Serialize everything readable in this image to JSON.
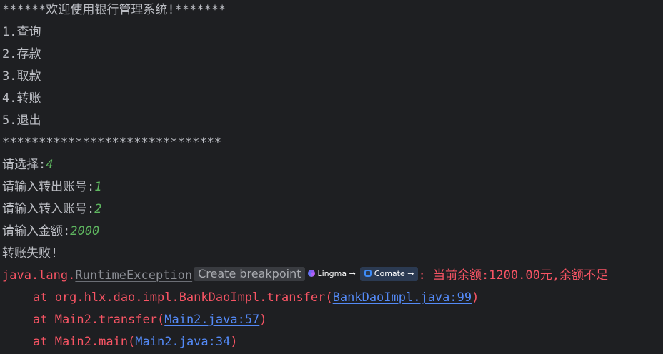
{
  "console": {
    "welcome": "******欢迎使用银行管理系统!*******",
    "menu": [
      "1.查询",
      "2.存款",
      "3.取款",
      "4.转账",
      "5.退出"
    ],
    "separator": "******************************",
    "prompt_choice": "请选择:",
    "input_choice": "4",
    "prompt_from": "请输入转出账号:",
    "input_from": "1",
    "prompt_to": "请输入转入账号:",
    "input_to": "2",
    "prompt_amount": "请输入金额:",
    "input_amount": "2000",
    "result": "转账失败!",
    "exception": {
      "package": "java.lang.",
      "class": "RuntimeException",
      "message": ": 当前余额:1200.00元,余额不足",
      "stack": [
        {
          "prefix": "at org.hlx.dao.impl.BankDaoImpl.transfer(",
          "link": "BankDaoImpl.java:99",
          "suffix": ")"
        },
        {
          "prefix": "at Main2.transfer(",
          "link": "Main2.java:57",
          "suffix": ")"
        },
        {
          "prefix": "at Main2.main(",
          "link": "Main2.java:34",
          "suffix": ")"
        }
      ]
    }
  },
  "widgets": {
    "create_breakpoint": "Create breakpoint",
    "lingma_label": "Lingma →",
    "comate_label": "Comate →",
    "lingma_icon": "lingma-logo-icon",
    "comate_icon": "comate-logo-icon"
  },
  "colors": {
    "background": "#1e1f22",
    "text": "#bcbec4",
    "input": "#5fb760",
    "error": "#f75464",
    "link": "#548af7"
  }
}
